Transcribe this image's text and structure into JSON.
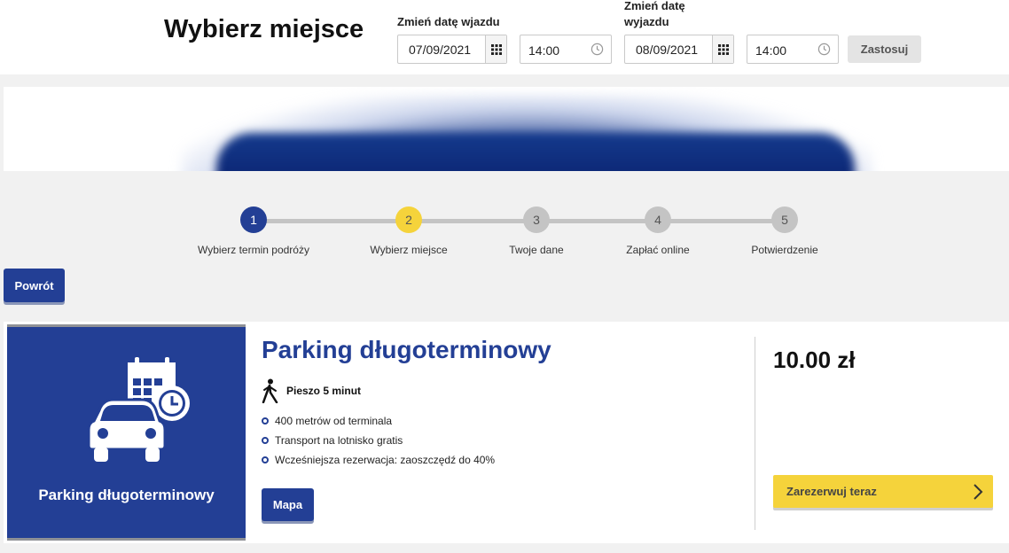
{
  "header": {
    "title": "Wybierz miejsce",
    "arrival_label": "Zmień datę wjazdu",
    "departure_label_line1": "Zmień datę",
    "departure_label_line2": "wyjazdu",
    "arrival_date": "07/09/2021",
    "arrival_time": "14:00",
    "departure_date": "08/09/2021",
    "departure_time": "14:00",
    "apply_label": "Zastosuj"
  },
  "steps": [
    {
      "number": "1",
      "label": "Wybierz termin podróży",
      "state": "done"
    },
    {
      "number": "2",
      "label": "Wybierz miejsce",
      "state": "current"
    },
    {
      "number": "3",
      "label": "Twoje dane",
      "state": "todo"
    },
    {
      "number": "4",
      "label": "Zapłać online",
      "state": "todo"
    },
    {
      "number": "5",
      "label": "Potwierdzenie",
      "state": "todo"
    }
  ],
  "back_label": "Powrót",
  "product": {
    "image_title": "Parking długoterminowy",
    "title": "Parking długoterminowy",
    "walk_text": "Pieszo 5 minut",
    "features": [
      "400 metrów od terminala",
      "Transport na lotnisko gratis",
      "Wcześniejsza rezerwacja: zaoszczędź do 40%"
    ],
    "map_label": "Mapa",
    "price": "10.00 zł",
    "reserve_label": "Zarezerwuj teraz"
  },
  "colors": {
    "primary": "#233f95",
    "accent": "#f5d33b",
    "inactive": "#c4c4c4"
  },
  "icons": [
    "calendar-grid-icon",
    "clock-icon",
    "car-calendar-icon",
    "walking-person-icon",
    "chevron-right-icon"
  ]
}
